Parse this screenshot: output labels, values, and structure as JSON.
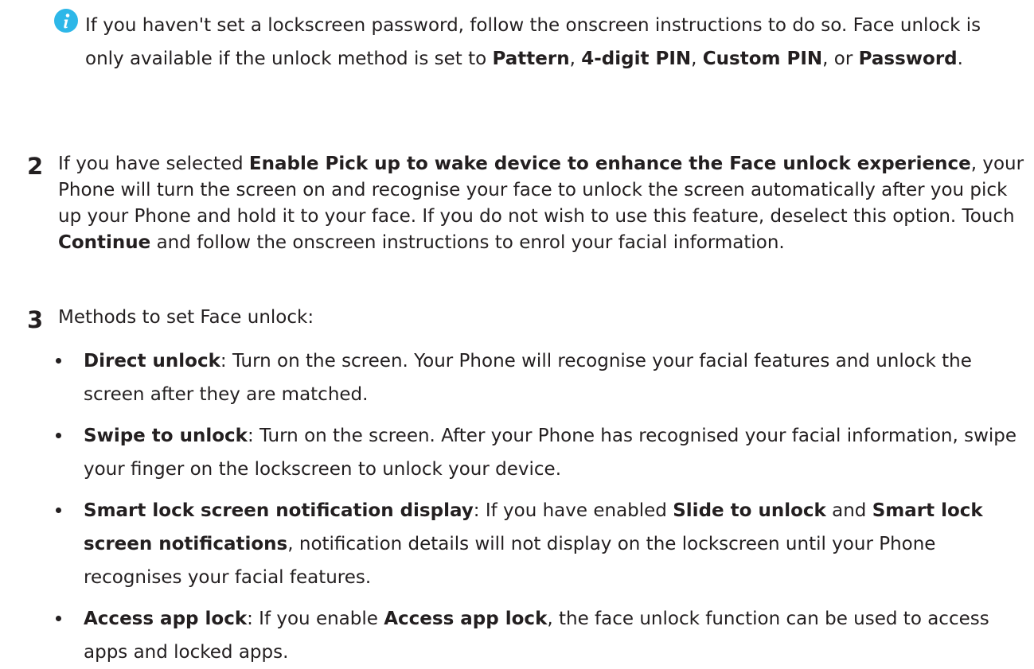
{
  "note": {
    "icon": "info-icon",
    "icon_color": "#2db7e8",
    "t1": "If you haven't set a lockscreen password, follow the onscreen instructions to do so. Face unlock is only available if the unlock method is set to ",
    "b1": "Pattern",
    "t2": ", ",
    "b2": "4-digit PIN",
    "t3": ", ",
    "b3": "Custom PIN",
    "t4": ", or ",
    "b4": "Password",
    "t5": "."
  },
  "step2": {
    "number": "2",
    "t1": "If you have selected ",
    "b1": "Enable Pick up to wake device to enhance the Face unlock experience",
    "t2": ", your Phone will turn the screen on and recognise your face to unlock the screen automatically after you pick up your Phone and hold it to your face. If you do not wish to use this feature, deselect this option. Touch ",
    "b2": "Continue",
    "t3": " and follow the onscreen instructions to enrol your facial information."
  },
  "step3": {
    "number": "3",
    "text": "Methods to set Face unlock:"
  },
  "bullets": [
    {
      "b1": "Direct unlock",
      "t1": ": Turn on the screen. Your Phone will recognise your facial features and unlock the screen after they are matched."
    },
    {
      "b1": "Swipe to unlock",
      "t1": ": Turn on the screen. After your Phone has recognised your facial information, swipe your finger on the lockscreen to unlock your device."
    },
    {
      "b1": "Smart lock screen notification display",
      "t1": ": If you have enabled ",
      "b2": "Slide to unlock",
      "t2": " and ",
      "b3": "Smart lock screen notifications",
      "t3": ", notification details will not display on the lockscreen until your Phone recognises your facial features."
    },
    {
      "b1": "Access app lock",
      "t1": ": If you enable ",
      "b2": "Access app lock",
      "t2": ", the face unlock function can be used to access apps and locked apps."
    }
  ]
}
